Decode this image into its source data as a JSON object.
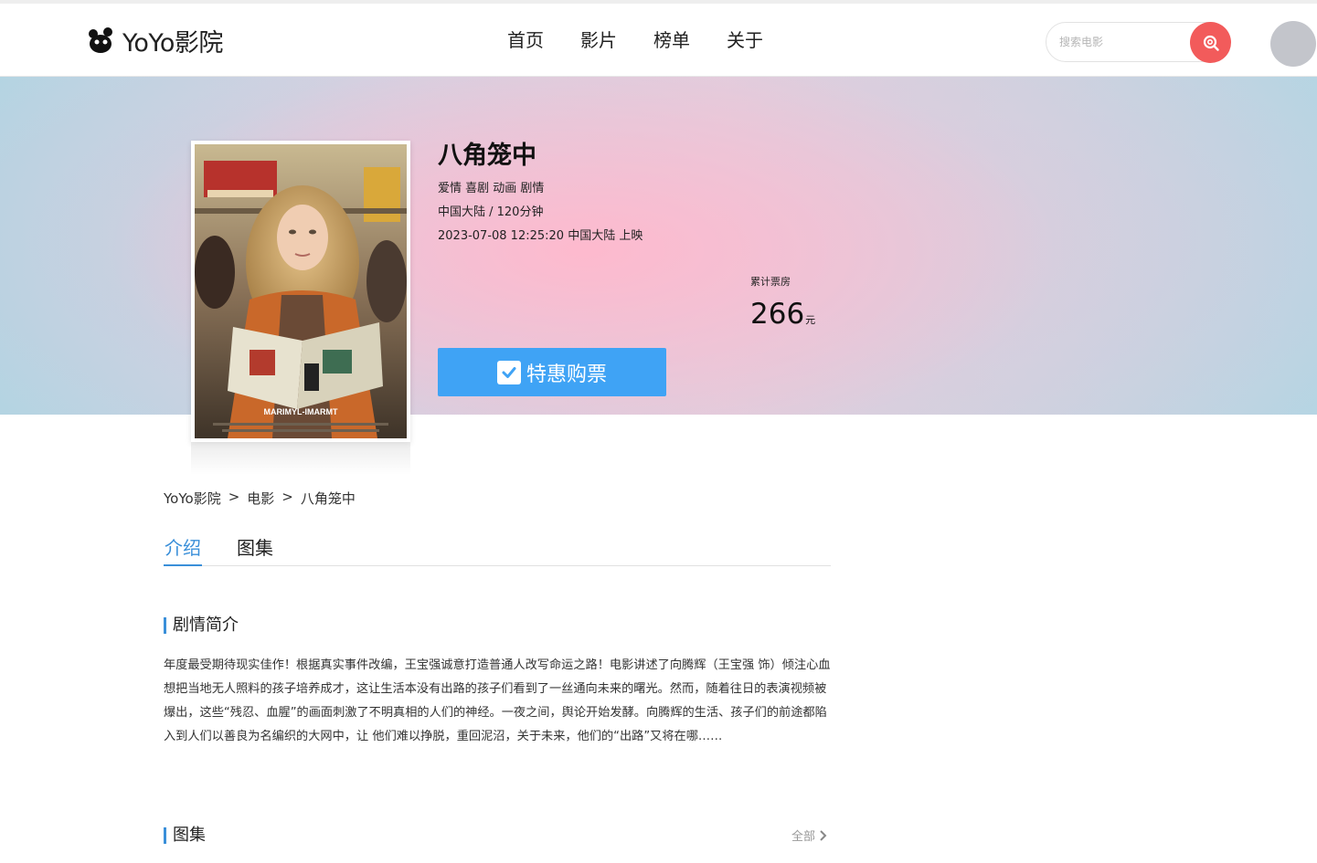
{
  "header": {
    "logo_text": "YoYo影院",
    "nav": [
      "首页",
      "影片",
      "榜单",
      "关于"
    ],
    "search_placeholder": "搜索电影"
  },
  "movie": {
    "title": "八角笼中",
    "genres": "爱情 喜剧 动画 剧情",
    "region_duration": "中国大陆 / 120分钟",
    "release": "2023-07-08 12:25:20 中国大陆 上映",
    "box_office_label": "累计票房",
    "box_office_value": "266",
    "box_office_unit": "元",
    "buy_label": "特惠购票"
  },
  "breadcrumb": [
    "YoYo影院",
    "电影",
    "八角笼中"
  ],
  "breadcrumb_sep": ">",
  "tabs": [
    "介绍",
    "图集"
  ],
  "sections": {
    "synopsis_title": "剧情简介",
    "synopsis_text": "年度最受期待现实佳作！根据真实事件改编，王宝强诚意打造普通人改写命运之路！电影讲述了向腾辉（王宝强 饰）倾注心血想把当地无人照料的孩子培养成才，这让生活本没有出路的孩子们看到了一丝通向未来的曙光。然而，随着往日的表演视频被爆出，这些“残忍、血腥”的画面刺激了不明真相的人们的神经。一夜之间，舆论开始发酵。向腾辉的生活、孩子们的前途都陷入到人们以善良为名编织的大网中，让 他们难以挣脱，重回泥沼，关于未来，他们的“出路”又将在哪……",
    "gallery_title": "图集",
    "gallery_all": "全部"
  },
  "colors": {
    "accent": "#3a8fd9",
    "buy_button": "#3fa3f5",
    "search_button": "#f25b5b"
  }
}
